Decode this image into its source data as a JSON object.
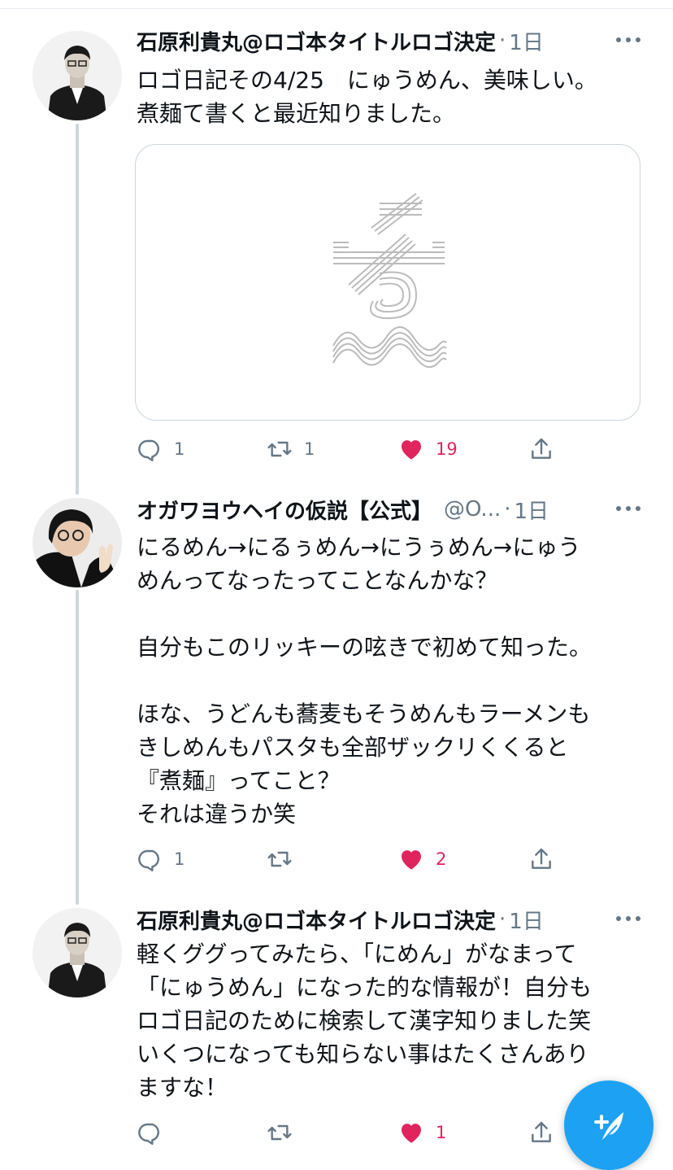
{
  "colors": {
    "accent": "#1da1f2",
    "like": "#e0245e",
    "muted": "#657786",
    "border": "#ccd6dd"
  },
  "tweets": [
    {
      "name": "石原利貴丸@ロゴ本タイトルロゴ決定",
      "handle": "",
      "time": "1日",
      "text": "ロゴ日記その4/25　にゅうめん、美味しい。\n煮麺て書くと最近知りました。",
      "has_media": true,
      "reply_count": "1",
      "retweet_count": "1",
      "like_count": "19",
      "liked": true
    },
    {
      "name": "オガワヨウヘイの仮説【公式】",
      "handle": "@O...",
      "time": "1日",
      "text": "にるめん→にるぅめん→にうぅめん→にゅう\nめんってなったってことなんかな？\n\n自分もこのリッキーの呟きで初めて知った。\n\nほな、うどんも蕎麦もそうめんもラーメンも\nきしめんもパスタも全部ザックリくくると\n『煮麺』ってこと？\nそれは違うか笑",
      "has_media": false,
      "reply_count": "1",
      "retweet_count": "",
      "like_count": "2",
      "liked": true
    },
    {
      "name": "石原利貴丸@ロゴ本タイトルロゴ決定",
      "handle": "",
      "time": "1日",
      "text": "軽くググってみたら、「にめん」がなまって\n「にゅうめん」になった的な情報が！自分も\nロゴ日記のために検索して漢字知りました笑\nいくつになっても知らない事はたくさんあり\nますな！",
      "has_media": false,
      "reply_count": "",
      "retweet_count": "",
      "like_count": "1",
      "liked": true
    }
  ],
  "compose": {
    "icon": "feather-plus-icon"
  }
}
